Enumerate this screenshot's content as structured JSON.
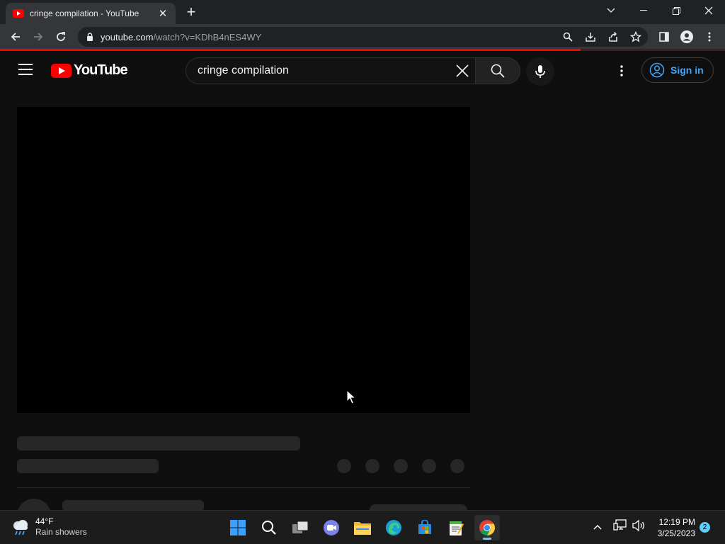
{
  "browser": {
    "tab_title": "cringe compilation - YouTube",
    "url_host": "youtube.com",
    "url_path": "/watch?v=KDhB4nES4WY"
  },
  "youtube": {
    "logo_text": "YouTube",
    "search_value": "cringe compilation",
    "signin_label": "Sign in",
    "video_loading": true
  },
  "taskbar": {
    "weather_temp": "44°F",
    "weather_condition": "Rain showers",
    "time": "12:19 PM",
    "date": "3/25/2023",
    "notification_count": "2"
  },
  "colors": {
    "yt_red": "#ff0000",
    "link_blue": "#3ea6ff",
    "background": "#0f0f0f"
  }
}
